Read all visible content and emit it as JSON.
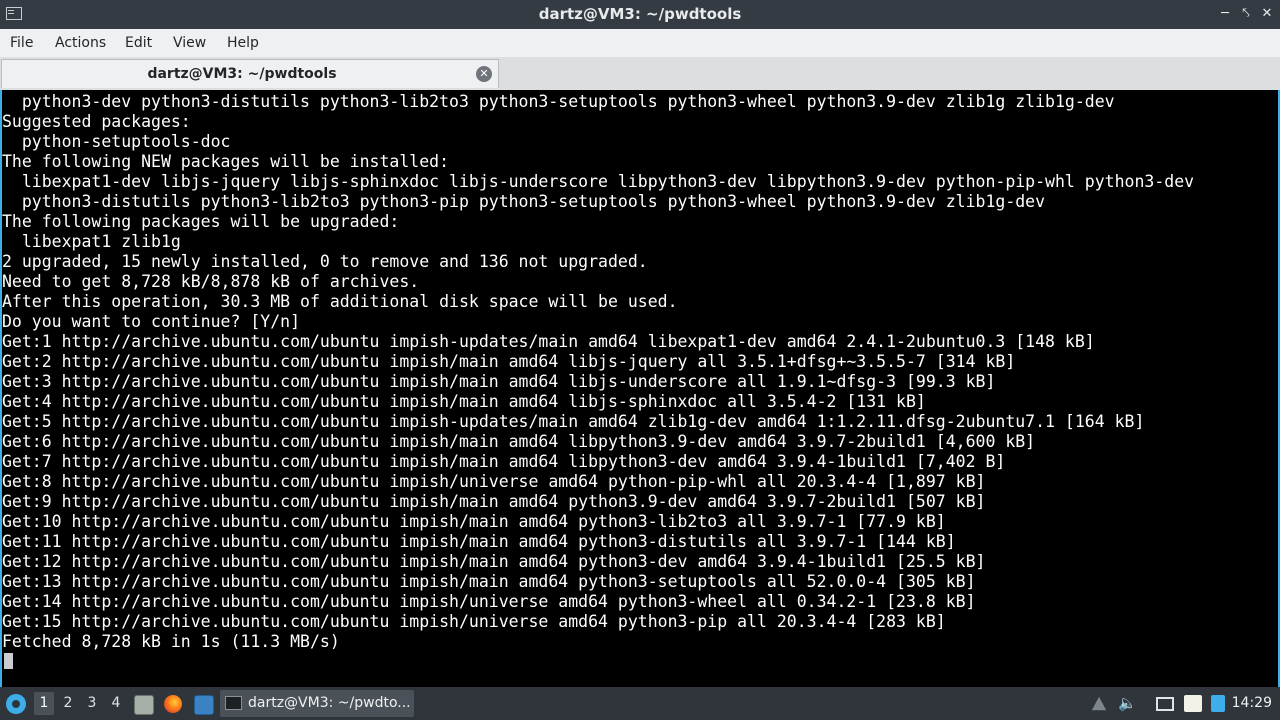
{
  "window": {
    "title": "dartz@VM3: ~/pwdtools",
    "window_icon": "terminal-window-icon",
    "controls": [
      "minimize-icon",
      "maximize-icon",
      "close-icon"
    ]
  },
  "menu": {
    "items": [
      "File",
      "Actions",
      "Edit",
      "View",
      "Help"
    ]
  },
  "tabs": [
    {
      "label": "dartz@VM3: ~/pwdtools",
      "close_icon": "close-icon"
    }
  ],
  "terminal": {
    "lines": [
      "  python3-dev python3-distutils python3-lib2to3 python3-setuptools python3-wheel python3.9-dev zlib1g zlib1g-dev",
      "Suggested packages:",
      "  python-setuptools-doc",
      "The following NEW packages will be installed:",
      "  libexpat1-dev libjs-jquery libjs-sphinxdoc libjs-underscore libpython3-dev libpython3.9-dev python-pip-whl python3-dev",
      "  python3-distutils python3-lib2to3 python3-pip python3-setuptools python3-wheel python3.9-dev zlib1g-dev",
      "The following packages will be upgraded:",
      "  libexpat1 zlib1g",
      "2 upgraded, 15 newly installed, 0 to remove and 136 not upgraded.",
      "Need to get 8,728 kB/8,878 kB of archives.",
      "After this operation, 30.3 MB of additional disk space will be used.",
      "Do you want to continue? [Y/n]",
      "Get:1 http://archive.ubuntu.com/ubuntu impish-updates/main amd64 libexpat1-dev amd64 2.4.1-2ubuntu0.3 [148 kB]",
      "Get:2 http://archive.ubuntu.com/ubuntu impish/main amd64 libjs-jquery all 3.5.1+dfsg+~3.5.5-7 [314 kB]",
      "Get:3 http://archive.ubuntu.com/ubuntu impish/main amd64 libjs-underscore all 1.9.1~dfsg-3 [99.3 kB]",
      "Get:4 http://archive.ubuntu.com/ubuntu impish/main amd64 libjs-sphinxdoc all 3.5.4-2 [131 kB]",
      "Get:5 http://archive.ubuntu.com/ubuntu impish-updates/main amd64 zlib1g-dev amd64 1:1.2.11.dfsg-2ubuntu7.1 [164 kB]",
      "Get:6 http://archive.ubuntu.com/ubuntu impish/main amd64 libpython3.9-dev amd64 3.9.7-2build1 [4,600 kB]",
      "Get:7 http://archive.ubuntu.com/ubuntu impish/main amd64 libpython3-dev amd64 3.9.4-1build1 [7,402 B]",
      "Get:8 http://archive.ubuntu.com/ubuntu impish/universe amd64 python-pip-whl all 20.3.4-4 [1,897 kB]",
      "Get:9 http://archive.ubuntu.com/ubuntu impish/main amd64 python3.9-dev amd64 3.9.7-2build1 [507 kB]",
      "Get:10 http://archive.ubuntu.com/ubuntu impish/main amd64 python3-lib2to3 all 3.9.7-1 [77.9 kB]",
      "Get:11 http://archive.ubuntu.com/ubuntu impish/main amd64 python3-distutils all 3.9.7-1 [144 kB]",
      "Get:12 http://archive.ubuntu.com/ubuntu impish/main amd64 python3-dev amd64 3.9.4-1build1 [25.5 kB]",
      "Get:13 http://archive.ubuntu.com/ubuntu impish/main amd64 python3-setuptools all 52.0.0-4 [305 kB]",
      "Get:14 http://archive.ubuntu.com/ubuntu impish/universe amd64 python3-wheel all 0.34.2-1 [23.8 kB]",
      "Get:15 http://archive.ubuntu.com/ubuntu impish/universe amd64 python3-pip all 20.3.4-4 [283 kB]",
      "Fetched 8,728 kB in 1s (11.3 MB/s)"
    ]
  },
  "taskbar": {
    "start_icon": "start-menu-icon",
    "workspaces": [
      "1",
      "2",
      "3",
      "4"
    ],
    "active_workspace": "1",
    "launchers": [
      "file-manager-icon",
      "firefox-icon",
      "desktop-icon"
    ],
    "task": {
      "label": "dartz@VM3: ~/pwdto...",
      "icon": "terminal-icon"
    },
    "tray": [
      "notifications-icon",
      "volume-icon",
      "display-icon",
      "clipboard-icon",
      "network-icon"
    ],
    "clock": "14:29"
  },
  "colors": {
    "titlebar_bg": "#343b43",
    "terminal_bg": "#000000",
    "terminal_fg": "#ffffff",
    "accent": "#3daee9",
    "taskbar_bg": "#2f353b"
  }
}
